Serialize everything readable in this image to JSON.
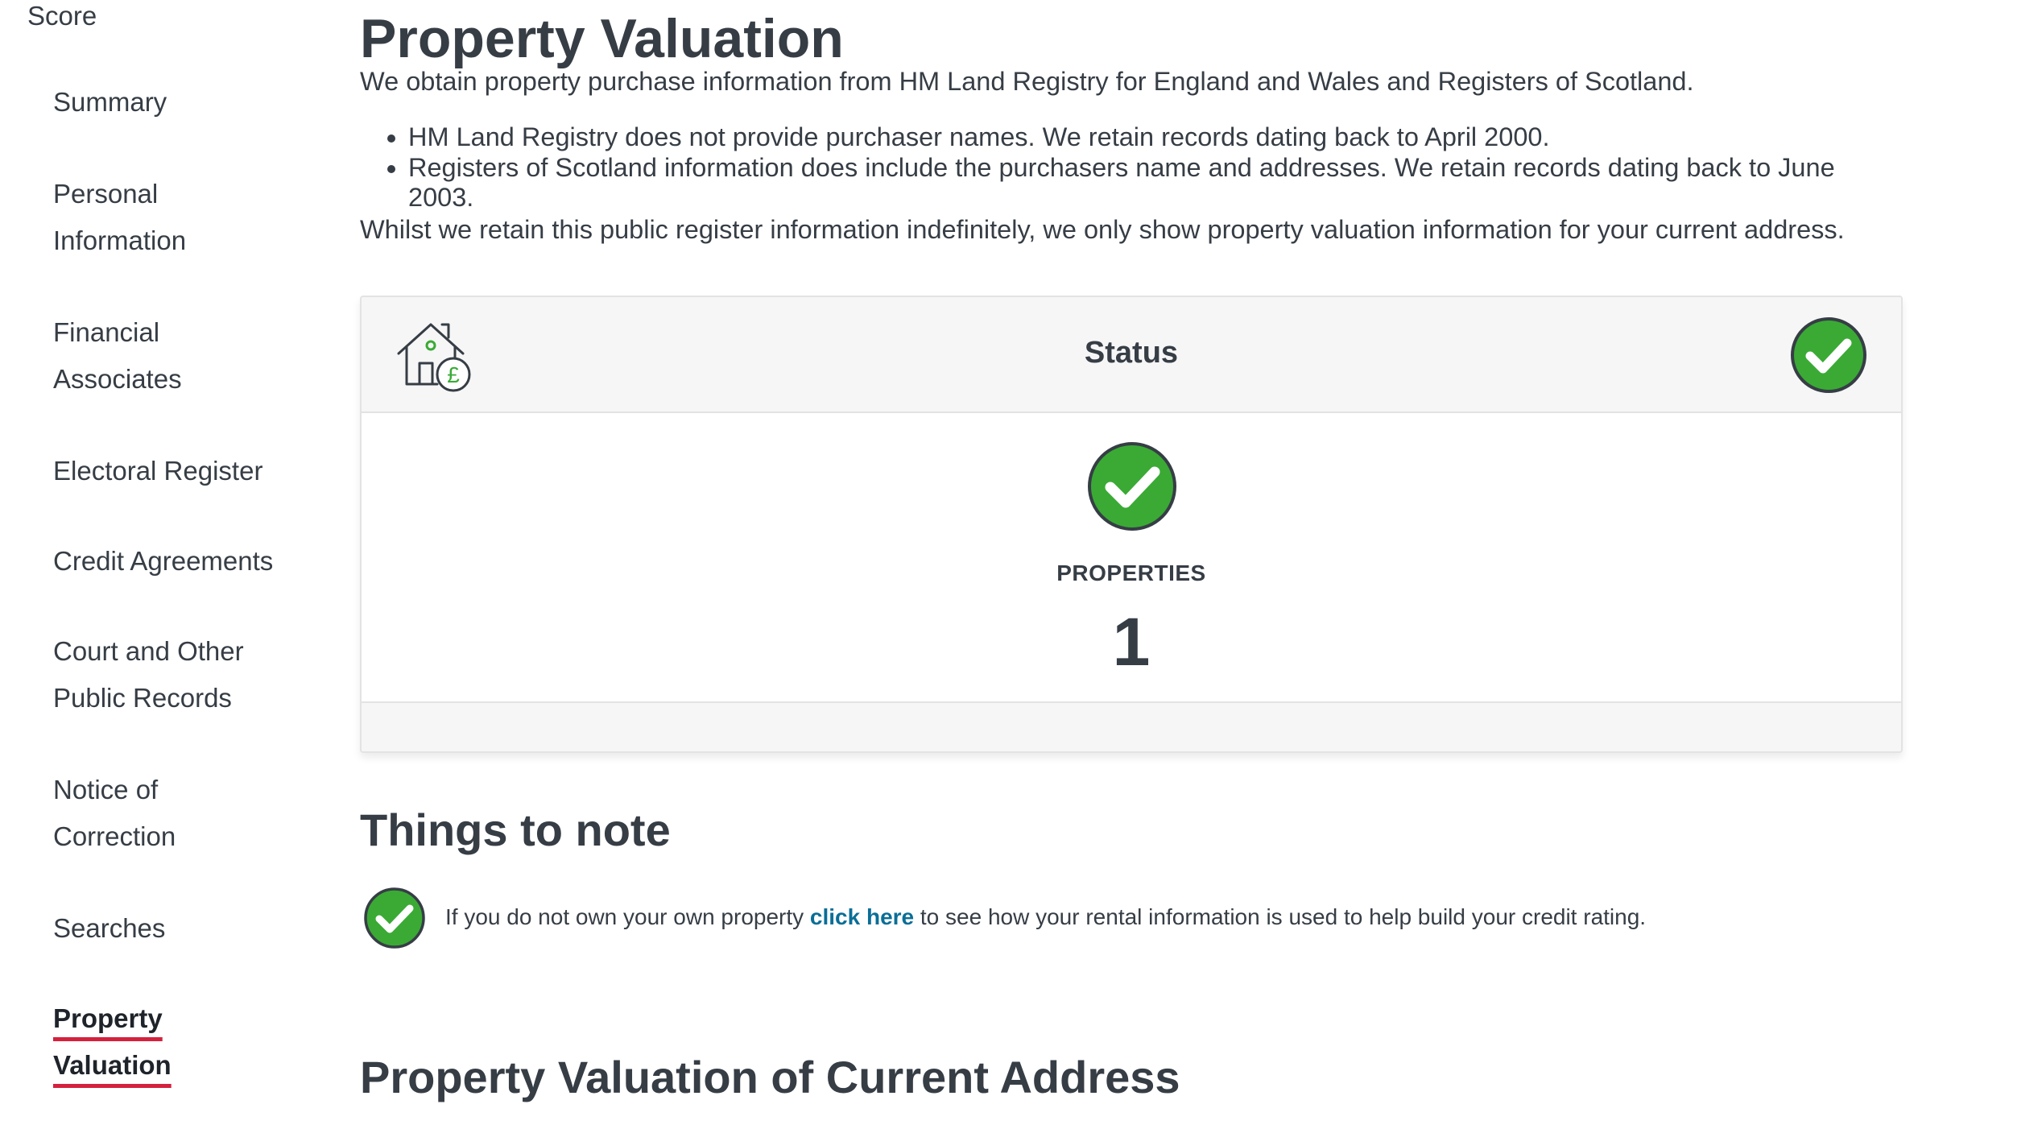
{
  "sidebar": {
    "score_label": "Score",
    "items": [
      {
        "lines": [
          "Summary"
        ]
      },
      {
        "lines": [
          "Personal",
          "Information"
        ]
      },
      {
        "lines": [
          "Financial",
          "Associates"
        ]
      },
      {
        "lines": [
          "Electoral Register"
        ]
      },
      {
        "lines": [
          "Credit Agreements"
        ]
      },
      {
        "lines": [
          "Court and Other",
          "Public Records"
        ]
      },
      {
        "lines": [
          "Notice of",
          "Correction"
        ]
      },
      {
        "lines": [
          "Searches"
        ]
      },
      {
        "lines": [
          "Property",
          "Valuation"
        ],
        "active": true
      }
    ]
  },
  "main": {
    "title": "Property Valuation",
    "intro": "We obtain property purchase information from HM Land Registry for England and Wales and Registers of Scotland.",
    "bullets": [
      "HM Land Registry does not provide purchaser names. We retain records dating back to April 2000.",
      "Registers of Scotland information does include the purchasers name and addresses. We retain records dating back to June 2003."
    ],
    "outro": "Whilst we retain this public register information indefinitely, we only show property valuation information for your current address."
  },
  "status_card": {
    "header_title": "Status",
    "header_icon": "house-pound-icon",
    "status_icon": "check-circle-icon",
    "label": "PROPERTIES",
    "count": "1"
  },
  "notes": {
    "title": "Things to note",
    "text_before": "If you do not own your own property ",
    "link_text": "click here",
    "text_after": " to see how your rental information is used to help build your credit rating."
  },
  "section2": {
    "title": "Property Valuation of Current Address"
  },
  "colors": {
    "accent_green": "#3aaa35",
    "link_blue": "#0a6e97",
    "active_underline": "#d4213d",
    "text": "#363d45"
  }
}
